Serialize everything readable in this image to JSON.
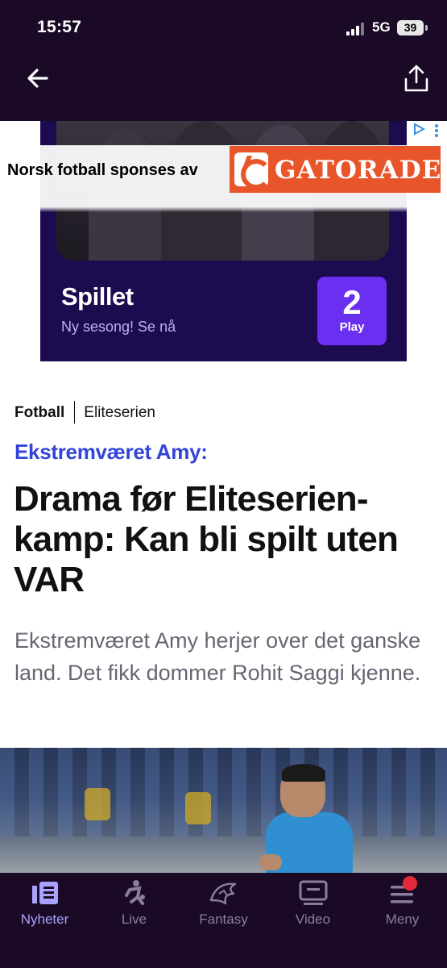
{
  "status": {
    "time": "15:57",
    "network": "5G",
    "battery": "39"
  },
  "header": {
    "back_icon": "arrow-left-icon",
    "share_icon": "share-icon"
  },
  "ad": {
    "sponsor_text": "Norsk fotball sponses av",
    "sponsor_brand": "GATORADE",
    "show_title": "Spillet",
    "show_subtitle": "Ny sesong! Se nå",
    "channel_number": "2",
    "channel_action": "Play",
    "colors": {
      "background": "#1d0b4f",
      "logo": "#6a2ff0",
      "gatorade": "#e8552a"
    }
  },
  "article": {
    "breadcrumb": {
      "section": "Fotball",
      "subsection": "Eliteserien"
    },
    "kicker": "Ekstremværet Amy:",
    "headline": "Drama før Eliteserien-kamp: Kan bli spilt uten VAR",
    "lead": "Ekstremværet Amy herjer over det ganske land. Det fikk dommer Rohit Saggi kjenne."
  },
  "tabs": [
    {
      "label": "Nyheter",
      "icon": "news-icon",
      "active": true
    },
    {
      "label": "Live",
      "icon": "player-icon",
      "active": false
    },
    {
      "label": "Fantasy",
      "icon": "fantasy-icon",
      "active": false
    },
    {
      "label": "Video",
      "icon": "video-icon",
      "active": false
    },
    {
      "label": "Meny",
      "icon": "menu-icon",
      "active": false,
      "badge": true
    }
  ],
  "colors": {
    "accent": "#3244d9",
    "bar": "#1a0a26",
    "tab_active": "#a9a3ff"
  }
}
